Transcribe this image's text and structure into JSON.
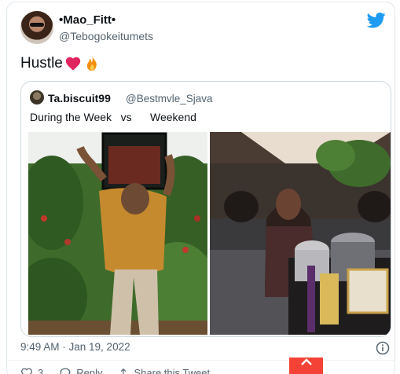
{
  "tweet": {
    "display_name": "•Mao_Fitt•",
    "handle": "@Tebogokeitumets",
    "text": "Hustle",
    "emojis": [
      "heart-emoji",
      "fire-emoji"
    ],
    "timestamp": "9:49 AM · Jan 19, 2022"
  },
  "quoted": {
    "display_name": "Ta.biscuit99",
    "handle": "@Bestmvle_Sjava",
    "text": "During the Week   vs      Weekend"
  },
  "actions": {
    "likes": "3",
    "reply_label": "Reply",
    "share_label": "Share this Tweet"
  },
  "colors": {
    "twitter_blue": "#1d9bf0",
    "heart_red": "#e0245e",
    "scroll_button_red": "#f44336",
    "muted_text": "#536471"
  },
  "icons": [
    "twitter-bird-icon",
    "info-icon",
    "heart-icon",
    "reply-icon",
    "share-icon",
    "chevron-up-icon"
  ]
}
